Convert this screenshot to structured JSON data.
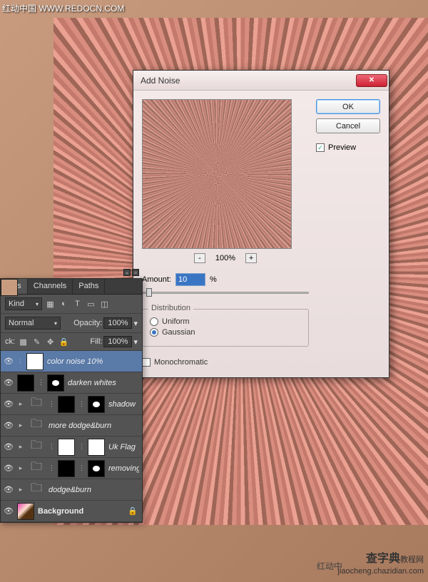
{
  "watermark": {
    "top_left": "红动中国 WWW.REDOCN.COM",
    "bottom_logo_main": "查字典",
    "bottom_logo_sub": "教程网",
    "bottom_url": "jiaocheng.chazidian.com",
    "bottom_left": "红动中"
  },
  "dialog": {
    "title": "Add Noise",
    "ok": "OK",
    "cancel": "Cancel",
    "preview_chk": "Preview",
    "zoom_pct": "100%",
    "amount_label": "Amount:",
    "amount_value": "10",
    "amount_suffix": "%",
    "distribution_legend": "Distribution",
    "uniform": "Uniform",
    "gaussian": "Gaussian",
    "mono": "Monochromatic"
  },
  "panel": {
    "tabs": [
      "yers",
      "Channels",
      "Paths"
    ],
    "kind": "Kind",
    "blend": "Normal",
    "opacity_label": "Opacity:",
    "opacity_val": "100%",
    "lock_label": "ck:",
    "fill_label": "Fill:",
    "fill_val": "100%",
    "layers": [
      {
        "name": "color noise 10%",
        "sel": true,
        "thumb": "skin",
        "mask": "white"
      },
      {
        "name": "darken whites",
        "thumb": "black",
        "mask": true
      },
      {
        "name": "shadow",
        "thumb": "black",
        "mask": true,
        "folder_like": true
      },
      {
        "name": "more dodge&burn",
        "folder": true
      },
      {
        "name": "Uk Flag",
        "thumb": "white",
        "mask": "white",
        "folder_like": true
      },
      {
        "name": "removing red",
        "thumb": "black",
        "mask": true,
        "folder_like": true
      },
      {
        "name": "dodge&burn",
        "folder": true
      },
      {
        "name": "Background",
        "thumb": "img",
        "bg": true
      }
    ]
  },
  "chart_data": {
    "type": "table",
    "categories": [],
    "values": []
  }
}
